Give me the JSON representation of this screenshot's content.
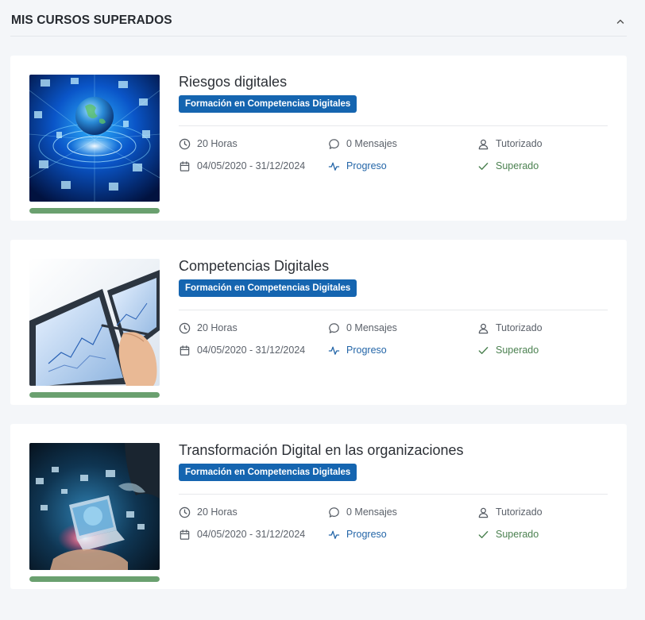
{
  "section": {
    "title": "MIS CURSOS SUPERADOS",
    "collapse_icon": "chevron-up-icon"
  },
  "courses": [
    {
      "title": "Riesgos digitales",
      "category": "Formación en Competencias Digitales",
      "hours": "20 Horas",
      "messages": "0 Mensajes",
      "tutoring": "Tutorizado",
      "dates": "04/05/2020 - 31/12/2024",
      "progress_label": "Progreso",
      "status": "Superado",
      "progress": 1.0,
      "image": "network-globe-image"
    },
    {
      "title": "Competencias Digitales",
      "category": "Formación en Competencias Digitales",
      "hours": "20 Horas",
      "messages": "0 Mensajes",
      "tutoring": "Tutorizado",
      "dates": "04/05/2020 - 31/12/2024",
      "progress_label": "Progreso",
      "status": "Superado",
      "progress": 1.0,
      "image": "screen-with-pen-image"
    },
    {
      "title": "Transformación Digital en las organizaciones",
      "category": "Formación en Competencias Digitales",
      "hours": "20 Horas",
      "messages": "0 Mensajes",
      "tutoring": "Tutorizado",
      "dates": "04/05/2020 - 31/12/2024",
      "progress_label": "Progreso",
      "status": "Superado",
      "progress": 1.0,
      "image": "digital-hand-laptop-image"
    }
  ],
  "colors": {
    "badge": "#1565b0",
    "progress": "#6aa06f",
    "link": "#2466a8",
    "success": "#4b8150",
    "background": "#f4f6f9"
  },
  "icons": {
    "hours": "clock-icon",
    "messages": "chat-bubble-icon",
    "tutoring": "user-icon",
    "dates": "calendar-icon",
    "progress": "activity-icon",
    "status": "check-icon"
  }
}
